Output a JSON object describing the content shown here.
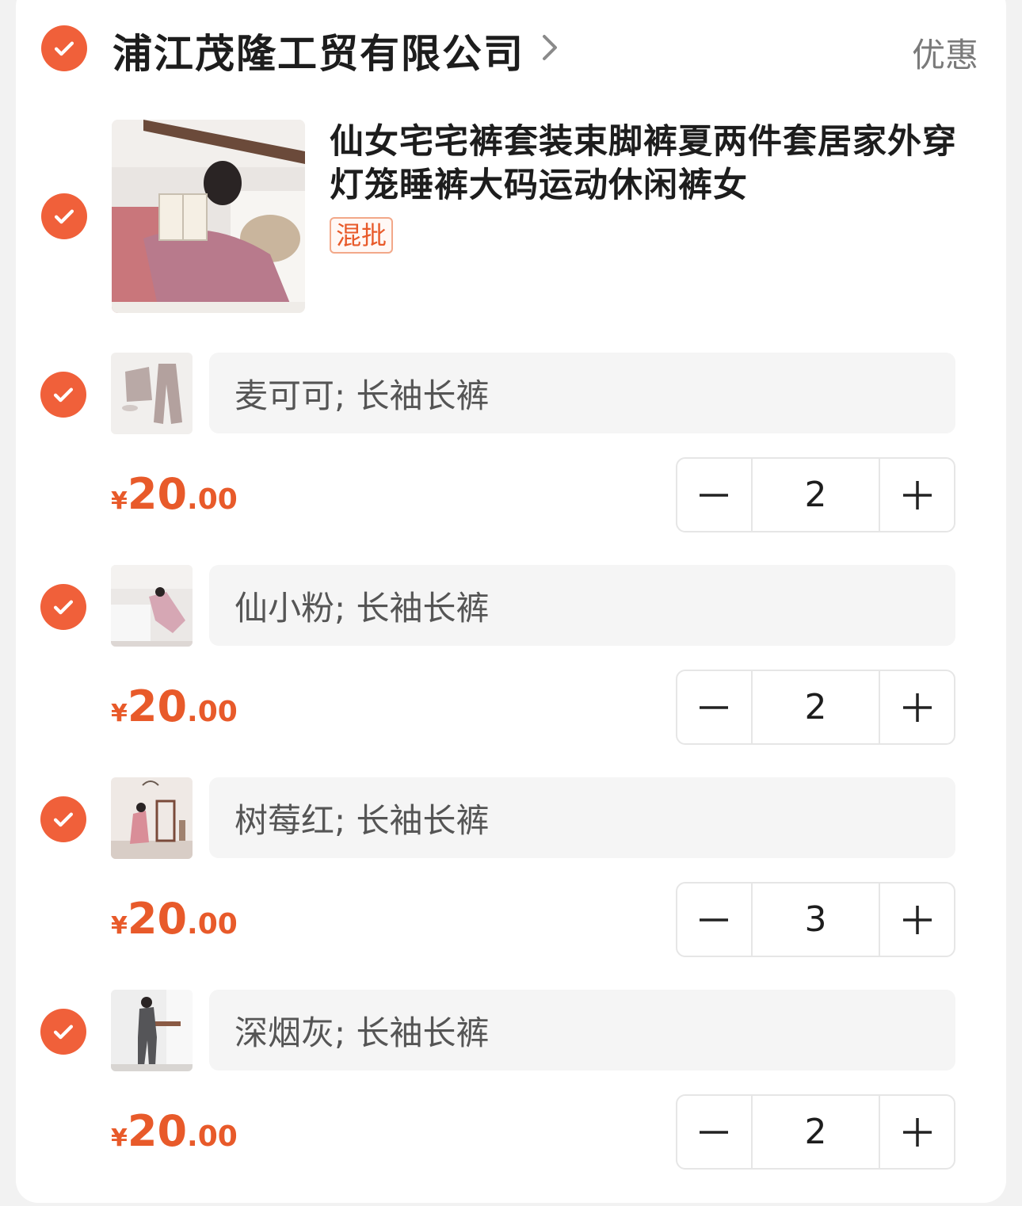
{
  "shop": {
    "name": "浦江茂隆工贸有限公司",
    "promo_label": "优惠"
  },
  "product": {
    "title": "仙女宅宅裤套装束脚裤夏两件套居家外穿灯笼睡裤大码运动休闲裤女",
    "tag": "混批"
  },
  "skus": [
    {
      "name": "麦可可; 长袖长裤",
      "currency": "¥",
      "price_int": "20",
      "price_dec": ".00",
      "qty": "2"
    },
    {
      "name": "仙小粉; 长袖长裤",
      "currency": "¥",
      "price_int": "20",
      "price_dec": ".00",
      "qty": "2"
    },
    {
      "name": "树莓红; 长袖长裤",
      "currency": "¥",
      "price_int": "20",
      "price_dec": ".00",
      "qty": "3"
    },
    {
      "name": "深烟灰; 长袖长裤",
      "currency": "¥",
      "price_int": "20",
      "price_dec": ".00",
      "qty": "2"
    }
  ],
  "colors": {
    "accent": "#f0603a",
    "price": "#e85a2a"
  }
}
